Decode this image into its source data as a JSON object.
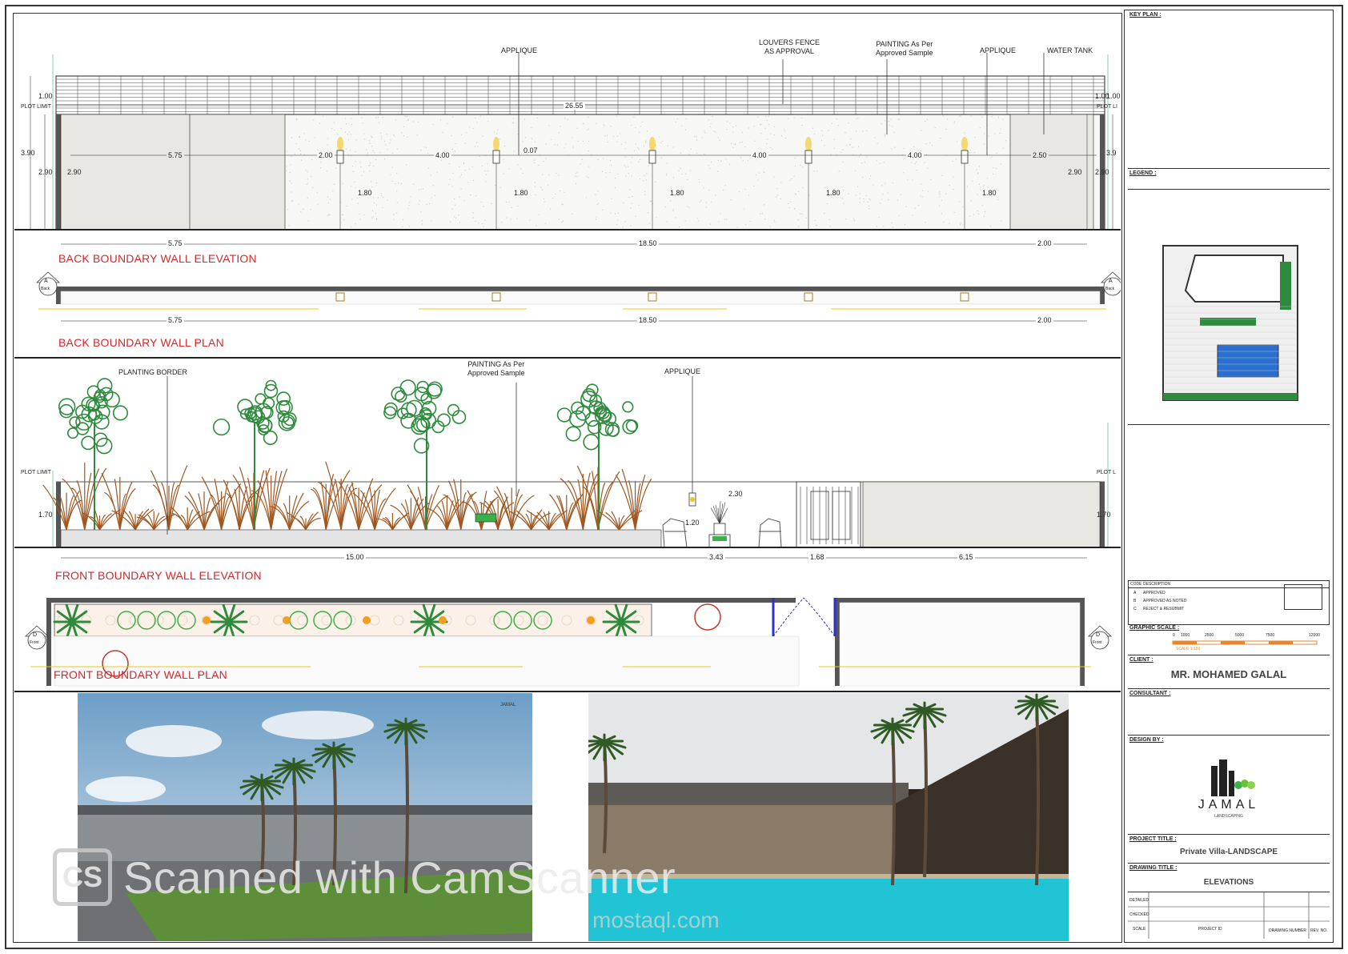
{
  "back_elevation": {
    "notes": {
      "applique_1": "APPLIQUE",
      "louvers": "LOUVERS FENCE\nAS APPROVAL",
      "painting": "PAINTING As Per\nApproved Sample",
      "applique_2": "APPLIQUE",
      "water_tank": "WATER TANK",
      "plot_limit_left": "PLOT LIMIT",
      "plot_limit_right": "PLOT LI"
    },
    "dims": {
      "top_height_left": "1.00",
      "top_height_right": "1.00",
      "top_height_right_inner": "1.00",
      "overall_width": "26.55",
      "total_height_left": "3.90",
      "total_height_right": "3.9",
      "wall_height_left_outer": "2.90",
      "wall_height_left_inner": "2.90",
      "wall_height_right_inner": "2.90",
      "wall_height_right_outer": "2.90",
      "seg_1": "5.75",
      "seg_2": "2.00",
      "seg_3": "4.00",
      "seg_4": "0.07",
      "seg_5": "4.00",
      "seg_6": "4.00",
      "seg_7": "2.50",
      "lamp_heights": [
        "1.80",
        "1.80",
        "1.80",
        "1.80",
        "1.80"
      ],
      "bottom_1": "5.75",
      "bottom_2": "18.50",
      "bottom_3": "2.00"
    },
    "title": "BACK BOUNDARY WALL ELEVATION"
  },
  "back_plan": {
    "dims": {
      "bottom_1": "5.75",
      "bottom_2": "18.50",
      "bottom_3": "2.00"
    },
    "marker_left": {
      "letter": "A",
      "label": "Back"
    },
    "marker_right": {
      "letter": "A",
      "label": "Back"
    },
    "title": "BACK BOUNDARY WALL PLAN"
  },
  "front_elevation": {
    "notes": {
      "planting_border": "PLANTING BORDER",
      "painting": "PAINTING As Per\nApproved Sample",
      "applique": "APPLIQUE",
      "plot_limit_left": "PLOT LIMIT",
      "plot_limit_right": "PLOT L"
    },
    "dims": {
      "height_left": "1.70",
      "height_right": "1.70",
      "width_seat": "2.30",
      "lamp_height": "1.20",
      "bottom_1": "15.00",
      "bottom_2": "3.43",
      "bottom_3": "1.68",
      "bottom_4": "6.15"
    },
    "title": "FRONT BOUNDARY WALL ELEVATION"
  },
  "front_plan": {
    "marker_left": {
      "letter": "D",
      "label": "Front"
    },
    "marker_right": {
      "letter": "D",
      "label": "Front"
    },
    "title": "FRONT BOUNDARY WALL PLAN"
  },
  "title_block": {
    "key_plan_label": "KEY PLAN :",
    "legend_label": "LEGEND :",
    "revisions": {
      "headers": [
        "CODE",
        "DESCRIPTION"
      ],
      "rows": [
        {
          "code": "A",
          "desc": "APPROVED"
        },
        {
          "code": "B",
          "desc": "APPROVED AS NOTED"
        },
        {
          "code": "C",
          "desc": "REJECT & RESUBMIT"
        }
      ]
    },
    "graphic_scale_label": "GRAPHIC SCALE :",
    "scale_ticks": [
      "0",
      "1000",
      "2500",
      "5000",
      "7500",
      "12000"
    ],
    "scale_note": "SCALE 1:150",
    "client_label": "CLIENT :",
    "client_name": "MR. MOHAMED GALAL",
    "consultant_label": "CONSULTANT :",
    "design_by_label": "DESIGN BY :",
    "logo_text": "JAMAL",
    "logo_sub": "LANDSCAPING",
    "project_title_label": "PROJECT TITLE :",
    "project_title": "Private Villa-LANDSCAPE",
    "drawing_title_label": "DRAWING TITLE :",
    "drawing_title": "ELEVATIONS",
    "footer": {
      "detailed": "DETAILED",
      "checked": "CHECKED",
      "scale": "SCALE",
      "project_id": "PROJECT ID",
      "drawing_number": "DRAWING NUMBER",
      "rev_no": "REV. NO."
    }
  },
  "photo_1_badge": "JAMAL",
  "watermark": {
    "logo": "CS",
    "text": "Scanned with CamScanner",
    "site": "mostaql.com"
  },
  "colors": {
    "title_red": "#d6262b",
    "tree_green": "#2e8b3e",
    "shrub_brown": "#a0561f",
    "lamp_yellow": "#f0c419",
    "pool_blue": "#2a6fd0"
  }
}
